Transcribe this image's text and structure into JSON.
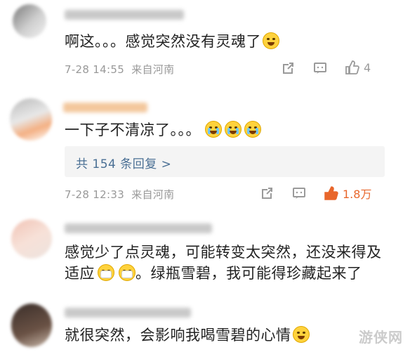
{
  "comments": [
    {
      "text": "啊这。。。感觉突然没有灵魂了",
      "time": "7-28 14:55",
      "location": "来自河南",
      "likes": "4"
    },
    {
      "text": "一下子不清凉了。。。",
      "time": "7-28 12:33",
      "location": "来自河南",
      "likes": "1.8万",
      "replies_label": "共 154 条回复 >"
    },
    {
      "text_line1": "感觉少了点灵魂，可能转变太突然，还没来得及",
      "text_line2a": "适应",
      "text_line2b": "。绿瓶雪碧，我可能得珍藏起来了"
    },
    {
      "text": "就很突然，会影响我喝雪碧的心情"
    }
  ],
  "icons": {
    "share": "share-icon",
    "comment": "comment-icon",
    "like": "thumbs-up-icon",
    "emoji_laugh_cry": "laugh-cry-emoji",
    "emoji_crying": "crying-emoji",
    "emoji_mask": "mask-emoji"
  },
  "colors": {
    "link": "#4a6f94",
    "meta": "#999999",
    "liked": "#e8662b"
  },
  "watermark": "游侠网"
}
